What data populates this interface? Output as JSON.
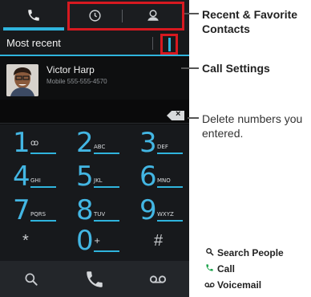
{
  "tabs": {
    "items": [
      {
        "name": "phone-tab",
        "icon": "phone-icon"
      },
      {
        "name": "recent-tab",
        "icon": "clock-icon"
      },
      {
        "name": "favorites-tab",
        "icon": "person-icon"
      }
    ]
  },
  "recent": {
    "label": "Most recent"
  },
  "contact": {
    "name": "Victor Harp",
    "detail": "Mobile 555-555-4570"
  },
  "keypad": {
    "keys": [
      {
        "digit": "1",
        "letters": "",
        "voicemail": true
      },
      {
        "digit": "2",
        "letters": "ABC"
      },
      {
        "digit": "3",
        "letters": "DEF"
      },
      {
        "digit": "4",
        "letters": "GHI"
      },
      {
        "digit": "5",
        "letters": "JKL"
      },
      {
        "digit": "6",
        "letters": "MNO"
      },
      {
        "digit": "7",
        "letters": "PQRS"
      },
      {
        "digit": "8",
        "letters": "TUV"
      },
      {
        "digit": "9",
        "letters": "WXYZ"
      },
      {
        "digit": "*",
        "letters": ""
      },
      {
        "digit": "0",
        "letters": "+"
      },
      {
        "digit": "#",
        "letters": ""
      }
    ]
  },
  "annotations": {
    "recent_favorite": "Recent & Favorite Contacts",
    "call_settings": "Call Settings",
    "delete_numbers": "Delete numbers you entered.",
    "search_people": "Search People",
    "call": "Call",
    "voicemail": "Voicemail"
  },
  "colors": {
    "accent": "#2fb4dd",
    "highlight": "#d71920",
    "phone_bg": "#0c0c0d"
  }
}
